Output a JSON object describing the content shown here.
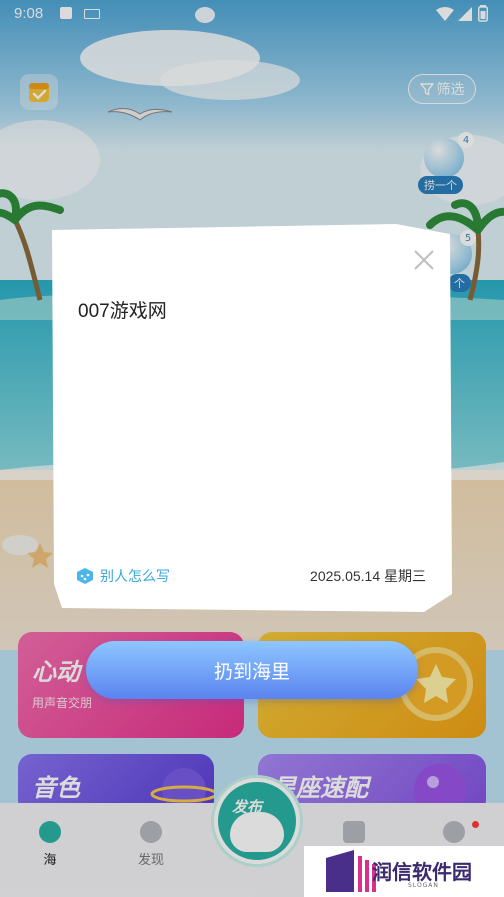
{
  "status_bar": {
    "time": "9:08"
  },
  "header": {
    "filter_label": "筛选"
  },
  "bottles": [
    {
      "count": "4",
      "label": "捞一个"
    },
    {
      "count": "5",
      "label": "个"
    }
  ],
  "cards": [
    {
      "title": "心动",
      "subtitle": "用声音交朋",
      "color": "#e84a9a"
    },
    {
      "title": "",
      "subtitle": "",
      "color": "#f2b21e"
    },
    {
      "title": "音色",
      "subtitle": "",
      "color": "#6a4ee0"
    },
    {
      "title": "星座速配",
      "subtitle": "",
      "color": "#9a5ee8"
    }
  ],
  "note": {
    "content": "007游戏网",
    "others_label": "别人怎么写",
    "date": "2025.05.14 星期三"
  },
  "throw_button": {
    "label": "扔到海里"
  },
  "tabs": [
    {
      "label": "海",
      "active": true
    },
    {
      "label": "发现",
      "active": false
    },
    {
      "label": "",
      "active": false
    },
    {
      "label": "",
      "active": false
    }
  ],
  "publish": {
    "label": "发布"
  },
  "watermark": {
    "text": "润信软件园",
    "sub": "SLOGAN"
  }
}
